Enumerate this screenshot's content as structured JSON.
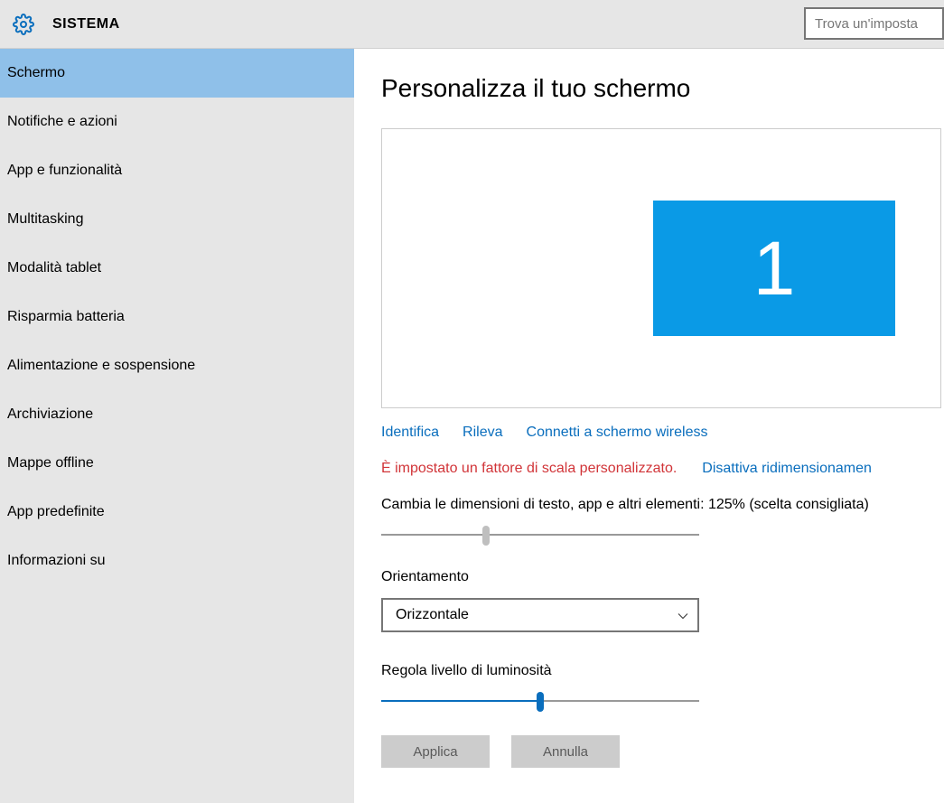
{
  "header": {
    "title": "SISTEMA"
  },
  "search": {
    "placeholder": "Trova un'imposta"
  },
  "sidebar": {
    "items": [
      "Schermo",
      "Notifiche e azioni",
      "App e funzionalità",
      "Multitasking",
      "Modalità tablet",
      "Risparmia batteria",
      "Alimentazione e sospensione",
      "Archiviazione",
      "Mappe offline",
      "App predefinite",
      "Informazioni su"
    ],
    "selected_index": 0
  },
  "main": {
    "title": "Personalizza il tuo schermo",
    "monitor_label": "1",
    "links": {
      "identify": "Identifica",
      "detect": "Rileva",
      "wireless": "Connetti a schermo wireless"
    },
    "scale_warning": "È impostato un fattore di scala personalizzato.",
    "disable_scaling": "Disattiva ridimensionamen",
    "scale_label": "Cambia le dimensioni di testo, app e altri elementi: 125% (scelta consigliata)",
    "scale_slider_percent": 33,
    "orientation_label": "Orientamento",
    "orientation_value": "Orizzontale",
    "brightness_label": "Regola livello di luminosità",
    "brightness_slider_percent": 50,
    "apply_label": "Applica",
    "cancel_label": "Annulla"
  }
}
